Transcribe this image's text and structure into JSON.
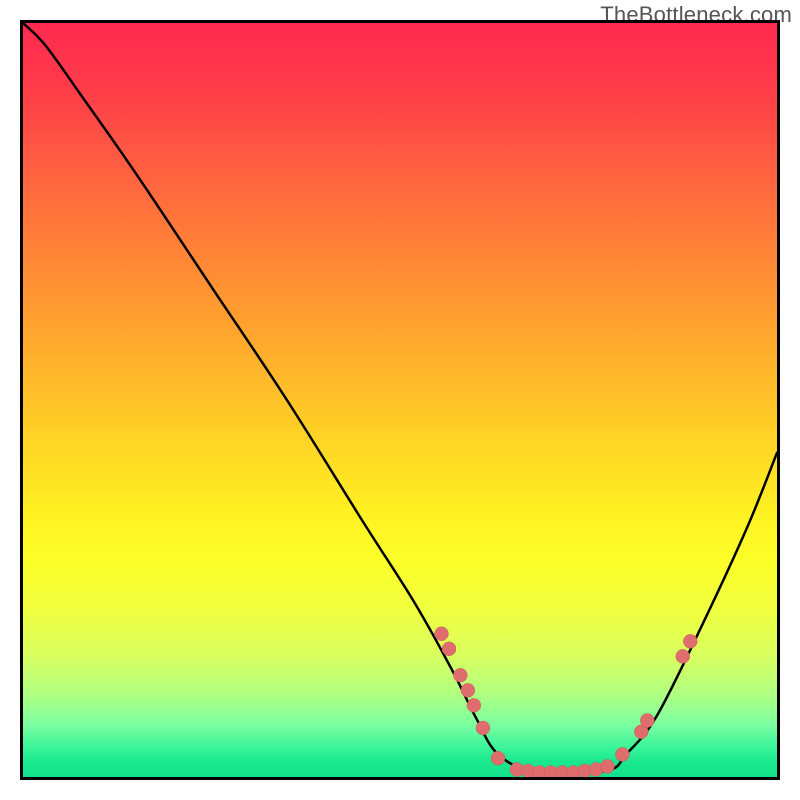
{
  "watermark": "TheBottleneck.com",
  "chart_data": {
    "type": "line",
    "title": "",
    "xlabel": "",
    "ylabel": "",
    "xlim": [
      0,
      100
    ],
    "ylim": [
      0,
      100
    ],
    "grid": false,
    "series": [
      {
        "name": "bottleneck-curve",
        "x": [
          0,
          3,
          8,
          15,
          25,
          35,
          45,
          52,
          57,
          60,
          63,
          68,
          73,
          78,
          80,
          84,
          90,
          96,
          100
        ],
        "y": [
          100,
          97,
          90,
          80,
          65,
          50,
          34,
          23,
          14,
          8,
          3,
          0.5,
          0.5,
          1,
          3,
          8,
          20,
          33,
          43
        ]
      }
    ],
    "markers": [
      {
        "x": 55.5,
        "y": 19
      },
      {
        "x": 56.5,
        "y": 17
      },
      {
        "x": 58,
        "y": 13.5
      },
      {
        "x": 59,
        "y": 11.5
      },
      {
        "x": 59.8,
        "y": 9.5
      },
      {
        "x": 61,
        "y": 6.5
      },
      {
        "x": 63,
        "y": 2.5
      },
      {
        "x": 65.5,
        "y": 1
      },
      {
        "x": 67,
        "y": 0.8
      },
      {
        "x": 68.5,
        "y": 0.6
      },
      {
        "x": 70,
        "y": 0.6
      },
      {
        "x": 71.5,
        "y": 0.6
      },
      {
        "x": 73,
        "y": 0.6
      },
      {
        "x": 74.5,
        "y": 0.8
      },
      {
        "x": 76,
        "y": 1
      },
      {
        "x": 77.5,
        "y": 1.4
      },
      {
        "x": 79.5,
        "y": 3
      },
      {
        "x": 82,
        "y": 6
      },
      {
        "x": 82.8,
        "y": 7.5
      },
      {
        "x": 87.5,
        "y": 16
      },
      {
        "x": 88.5,
        "y": 18
      }
    ]
  }
}
